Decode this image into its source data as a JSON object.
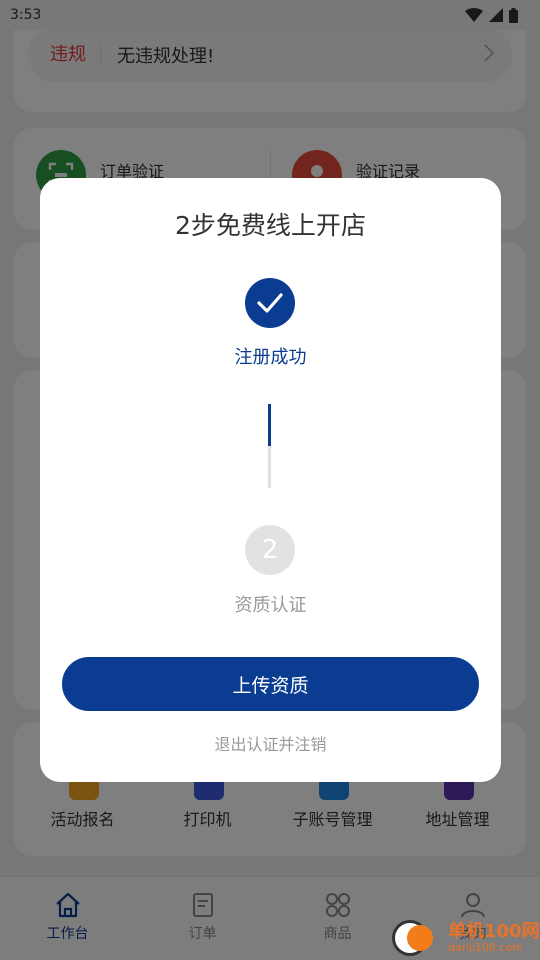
{
  "status_bar": {
    "time": "3:53",
    "icons": [
      "wifi-icon",
      "signal-icon",
      "battery-icon"
    ]
  },
  "background": {
    "violation": {
      "tag": "违规",
      "text": "无违规处理!"
    },
    "verify": {
      "left_label": "订单验证",
      "right_label": "验证记录"
    },
    "tools": [
      {
        "label": "活动报名",
        "color": "#f5a623"
      },
      {
        "label": "打印机",
        "color": "#3b5bdb"
      },
      {
        "label": "子账号管理",
        "color": "#1e88e5"
      },
      {
        "label": "地址管理",
        "color": "#5e35b1"
      }
    ]
  },
  "bottom_nav": {
    "items": [
      {
        "label": "工作台",
        "icon": "home-icon",
        "active": true
      },
      {
        "label": "订单",
        "icon": "document-icon",
        "active": false
      },
      {
        "label": "商品",
        "icon": "grid-icon",
        "active": false
      },
      {
        "label": "我的",
        "icon": "user-icon",
        "active": false
      }
    ]
  },
  "dialog": {
    "title": "2步免费线上开店",
    "steps": [
      {
        "label": "注册成功",
        "state": "done",
        "icon": "check-icon"
      },
      {
        "label": "资质认证",
        "state": "todo",
        "number": "2"
      }
    ],
    "progress": 0.5,
    "primary_button": "上传资质",
    "secondary_link": "退出认证并注销"
  },
  "watermark": {
    "name": "单机100网",
    "url": "danji100.com"
  },
  "colors": {
    "primary": "#0a3d91",
    "violation": "#e53935",
    "inactive": "#999999"
  }
}
